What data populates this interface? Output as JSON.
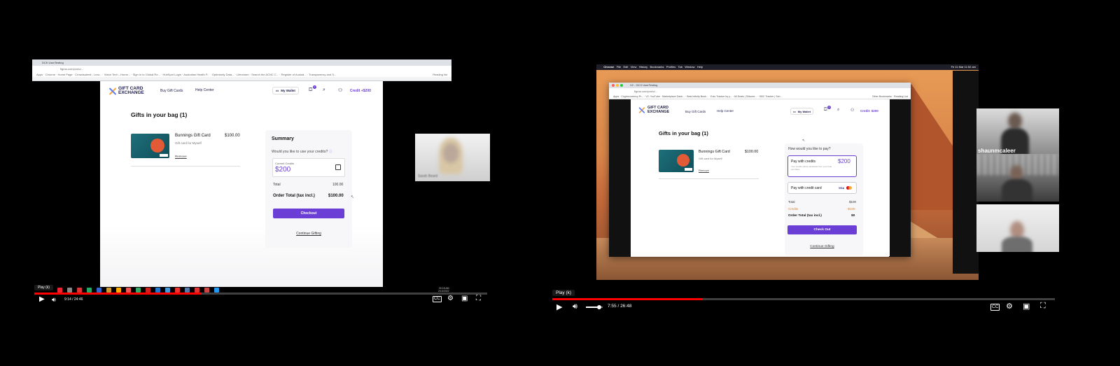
{
  "left_player": {
    "browser": {
      "tab_title": "DCK UserTesting",
      "url": "figma.com/proto/...",
      "bookmarks": [
        "Apps",
        "Chrome",
        "Home Page",
        "Crowdsubmit - Lear...",
        "Viator Tech - Home...",
        "Sign In to Global Re...",
        "HubSpot Login",
        "Australian Health P...",
        "Optimisely Data...",
        "Lifecream",
        "Search the ACNC C...",
        "Register of Austral...",
        "Transparency and S..."
      ],
      "reading_list": "Reading list"
    },
    "site": {
      "logo_line1": "GIFT CARD",
      "logo_line2": "EXCHANGE",
      "nav_buy": "Buy Gift Cards",
      "nav_help": "Help Center",
      "wallet": "My Wallet",
      "cart_badge": "1",
      "credit": "Credit +$200",
      "bag_title": "Gifts in your bag (1)",
      "product_name": "Bunnings Gift Card",
      "product_price": "$100.00",
      "product_sub": "Gift card for Myself",
      "remove": "Remove",
      "summary_title": "Summary",
      "credits_question": "Would you like to use your credits?",
      "current_credits_label": "Current Credits",
      "current_credits_value": "$200",
      "total_label": "Total",
      "total_value": "100.00",
      "order_total_label": "Order Total (tax incl.)",
      "order_total_value": "$100.00",
      "checkout": "Checkout",
      "continue": "Continue Gifting"
    },
    "webcam_label": "Sarah Beard",
    "taskbar_time": "09:18 AM",
    "taskbar_date": "2/10/2022",
    "tooltip": "Play (k)",
    "time": "9:14 / 24:46",
    "progress": 0.37
  },
  "right_player": {
    "menubar": [
      "Chrome",
      "File",
      "Edit",
      "View",
      "History",
      "Bookmarks",
      "Profiles",
      "Tab",
      "Window",
      "Help"
    ],
    "menubar_clock": "Fri 11 Mar 11:52 am",
    "browser": {
      "tab_title": "V2 - GCX UserTesting",
      "url": "figma.com/proto/...",
      "bookmarks": [
        "Apps",
        "Cryptocurrency Pr...",
        "V2: YouTube",
        "Marketplace Dash...",
        "Best Infinity Book...",
        "Ecto Tracker by y...",
        "All Deals | Silicone...",
        "GBC Tracker | Sch..."
      ],
      "other_bookmarks": "Other Bookmarks",
      "reading_list": "Reading List"
    },
    "site": {
      "logo_line1": "GIFT CARD",
      "logo_line2": "EXCHANGE",
      "nav_buy": "Buy Gift Cards",
      "nav_help": "Help Center",
      "wallet": "My Wallet",
      "cart_badge": "1",
      "credit": "Credit: $200",
      "bag_title": "Gifts in your bag (1)",
      "product_name": "Bunnings Gift Card",
      "product_price": "$100.00",
      "product_sub": "Gift card for Myself",
      "remove": "Remove",
      "pay_question": "How would you like to pay?",
      "pay_credits": "Pay with credits",
      "pay_credits_amount": "$200",
      "pay_credits_note": "Your credits will be deducted from your final purchase.",
      "pay_card": "Pay with credit card",
      "card_brand": "VISA",
      "total_label": "Total",
      "total_value": "$100",
      "credits_label": "Credits",
      "credits_value": "-$100",
      "order_total_label": "Order Total (tax incl.)",
      "order_total_value": "$0",
      "checkout": "Check Out",
      "continue": "Continue Gifting"
    },
    "webcam_name": "shaunmcaleer",
    "tooltip": "Play (k)",
    "time": "7:55 / 26:48",
    "progress": 0.3,
    "volume": 0.8
  },
  "colors": {
    "brand_purple": "#6b3fd6",
    "youtube_red": "#ff0000"
  }
}
